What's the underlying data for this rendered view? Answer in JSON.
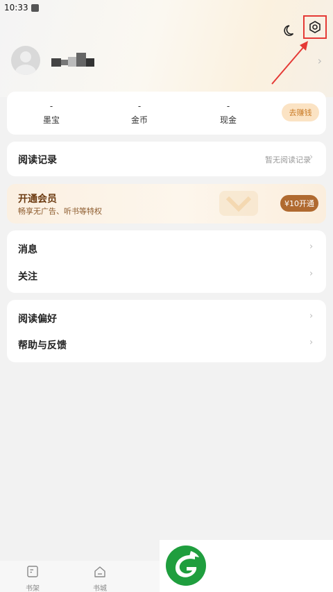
{
  "status_bar": {
    "time": "10:33"
  },
  "header": {
    "night_mode_icon": "moon-icon",
    "settings_icon": "gear-icon",
    "highlight_color": "#e53935"
  },
  "profile": {
    "avatar_icon": "user-avatar-icon"
  },
  "assets": {
    "items": [
      {
        "value": "-",
        "label": "墨宝"
      },
      {
        "value": "-",
        "label": "金币"
      },
      {
        "value": "-",
        "label": "现金"
      }
    ],
    "earn_button": "去赚钱"
  },
  "history": {
    "title": "阅读记录",
    "status": "暂无阅读记录"
  },
  "vip": {
    "title": "开通会员",
    "subtitle": "畅享无广告、听书等特权",
    "button": "¥10开通"
  },
  "menu_group_1": [
    {
      "label": "消息"
    },
    {
      "label": "关注"
    }
  ],
  "menu_group_2": [
    {
      "label": "阅读偏好"
    },
    {
      "label": "帮助与反馈"
    }
  ],
  "bottom_nav": [
    {
      "label": "书架",
      "icon": "bookshelf-icon"
    },
    {
      "label": "书城",
      "icon": "home-icon"
    }
  ],
  "colors": {
    "accent_orange": "#c97a25",
    "vip_brown": "#b06a30",
    "logo_green": "#1f9e3e"
  }
}
